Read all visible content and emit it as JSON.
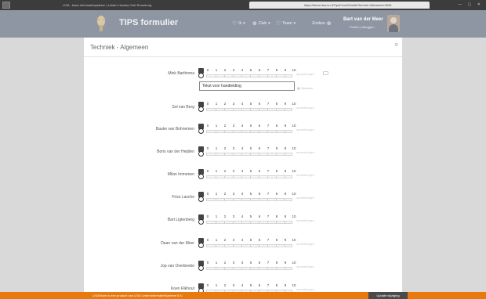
{
  "browser": {
    "tab_active": "LISA - team informatiesysteem | Leiden Hockey Club Roomburg",
    "tab_url": "https://team.lisa-is.nl/TipsForm/Details?formId=4&teamId=3581"
  },
  "header": {
    "app_title": "TIPS formulier",
    "nav": [
      {
        "label": "Ik",
        "icon": "trophy-icon",
        "glyph": "♡"
      },
      {
        "label": "Club",
        "icon": "globe-icon",
        "glyph": "⊕"
      },
      {
        "label": "Team",
        "icon": "trophy-icon",
        "glyph": "♡"
      },
      {
        "label": "Zoeken",
        "icon": "search-icon",
        "glyph": "⊕"
      }
    ],
    "user_name": "Bart van der Meer",
    "profile_link": "Profiel",
    "separator": "|",
    "logout_link": "Uitloggen"
  },
  "page": {
    "title": "Techniek - Algemeen",
    "gear_icon": "gear-icon",
    "scale": [
      "0",
      "1",
      "2",
      "3",
      "4",
      "5",
      "6",
      "7",
      "8",
      "9",
      "10"
    ],
    "comment_label": "opmerkingen",
    "note_placeholder": "Tekst voor handleiding",
    "note_action": "Opslaan",
    "players": [
      {
        "name": "Mink Barthema",
        "value": 0,
        "expanded": true
      },
      {
        "name": "Sol van Berg",
        "value": 0
      },
      {
        "name": "Bauke van Bohnemen",
        "value": 0
      },
      {
        "name": "Boris van der Heijden",
        "value": 0
      },
      {
        "name": "Milan Immenen",
        "value": 0
      },
      {
        "name": "Friso Lasche",
        "value": 0
      },
      {
        "name": "Bart Ligtenberg",
        "value": 0
      },
      {
        "name": "Daan van der Meer",
        "value": 0
      },
      {
        "name": "Jop van Overbeeke",
        "value": 0
      },
      {
        "name": "Koen Rikhout",
        "value": 0
      }
    ]
  },
  "footer": {
    "text": "LISATeam is een product van LISA LedenInformatieSysteem B.V.",
    "button": "Update wijziging"
  }
}
